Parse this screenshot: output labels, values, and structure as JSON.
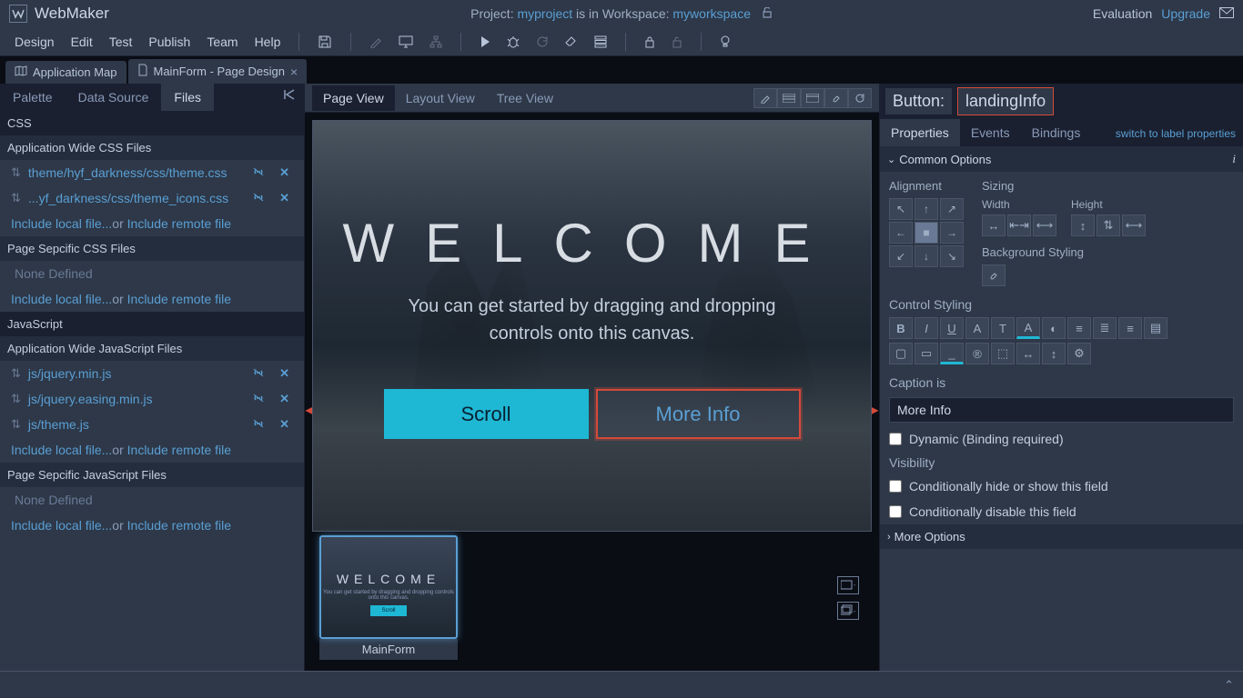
{
  "app": {
    "name": "WebMaker"
  },
  "project": {
    "prefix": "Project: ",
    "name": "myproject",
    "mid": " is in Workspace: ",
    "workspace": "myworkspace"
  },
  "titlebar_right": {
    "eval": "Evaluation",
    "upgrade": "Upgrade"
  },
  "menus": [
    "Design",
    "Edit",
    "Test",
    "Publish",
    "Team",
    "Help"
  ],
  "doc_tabs": {
    "appmap": "Application Map",
    "mainform": "MainForm - Page Design"
  },
  "left_tabs": {
    "palette": "Palette",
    "datasource": "Data Source",
    "files": "Files"
  },
  "files_panel": {
    "css_hdr": "CSS",
    "appwide_css": "Application Wide CSS Files",
    "css_files": [
      "theme/hyf_darkness/css/theme.css",
      "...yf_darkness/css/theme_icons.css"
    ],
    "include_local": "Include local file...",
    "or": "or ",
    "include_remote": "Include remote file",
    "pagespec_css": "Page Sepcific CSS Files",
    "none": "None Defined",
    "js_hdr": "JavaScript",
    "appwide_js": "Application Wide JavaScript Files",
    "js_files": [
      "js/jquery.min.js",
      "js/jquery.easing.min.js",
      "js/theme.js"
    ],
    "pagespec_js": "Page Sepcific JavaScript Files"
  },
  "view_tabs": {
    "page": "Page View",
    "layout": "Layout View",
    "tree": "Tree View"
  },
  "canvas": {
    "welcome": "WELCOME",
    "sub1": "You can get started by dragging and dropping",
    "sub2": "controls onto this canvas.",
    "scroll": "Scroll",
    "moreinfo": "More Info"
  },
  "thumb": {
    "label": "MainForm"
  },
  "inspector": {
    "type": "Button:",
    "name": "landingInfo",
    "tabs": {
      "props": "Properties",
      "events": "Events",
      "bindings": "Bindings"
    },
    "switch": "switch to label properties",
    "common": "Common Options",
    "more": "More Options",
    "alignment": "Alignment",
    "sizing": "Sizing",
    "width": "Width",
    "height": "Height",
    "bgstyling": "Background Styling",
    "ctrlstyling": "Control Styling",
    "caption_lbl": "Caption is",
    "caption_val": "More Info",
    "dynamic": "Dynamic (Binding required)",
    "visibility": "Visibility",
    "cond_hide": "Conditionally hide or show this field",
    "cond_disable": "Conditionally disable this field"
  }
}
